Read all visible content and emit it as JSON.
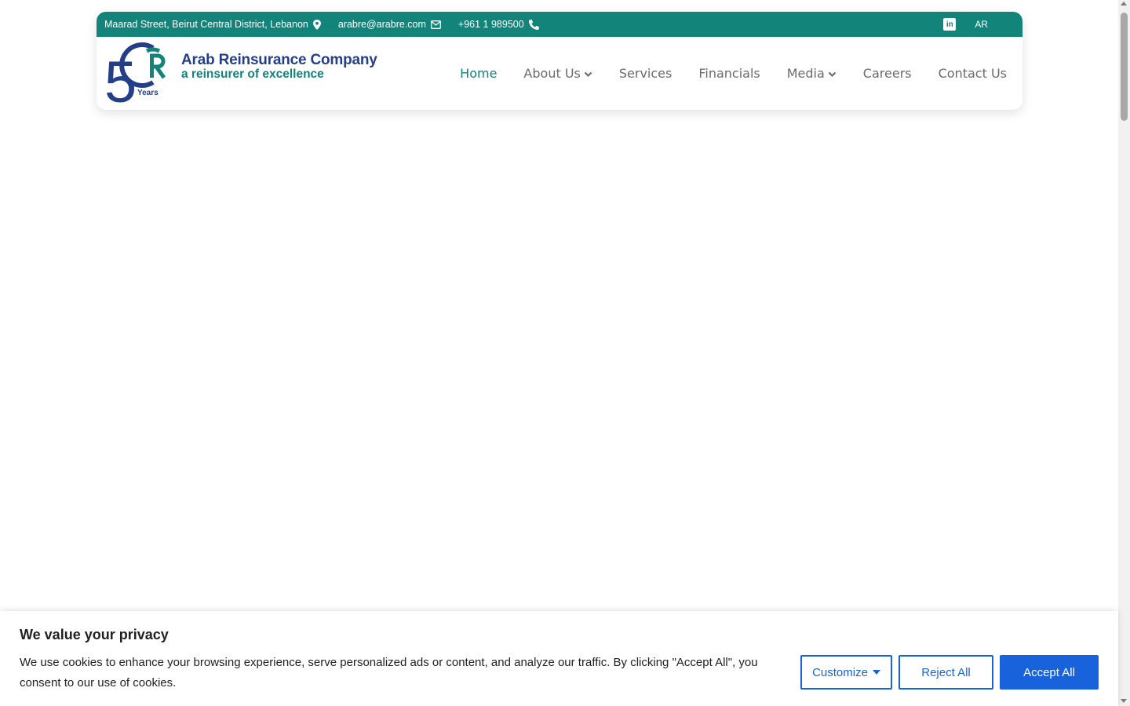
{
  "topbar": {
    "address": "Maarad Street, Beirut Central District, Lebanon",
    "email": "arabre@arabre.com",
    "phone": "+961 1 989500",
    "language": "AR",
    "icons": [
      "location-pin-icon",
      "envelope-icon",
      "phone-icon",
      "linkedin-icon"
    ]
  },
  "logo": {
    "number": "5",
    "years": "Years",
    "name": "Arab Reinsurance Company",
    "tagline": "a reinsurer of excellence"
  },
  "nav": {
    "items": [
      {
        "label": "Home",
        "active": true,
        "dropdown": false
      },
      {
        "label": "About Us",
        "active": false,
        "dropdown": true
      },
      {
        "label": "Services",
        "active": false,
        "dropdown": false
      },
      {
        "label": "Financials",
        "active": false,
        "dropdown": false
      },
      {
        "label": "Media",
        "active": false,
        "dropdown": true
      },
      {
        "label": "Careers",
        "active": false,
        "dropdown": false
      },
      {
        "label": "Contact Us",
        "active": false,
        "dropdown": false
      }
    ]
  },
  "cookie": {
    "title": "We value your privacy",
    "text": "We use cookies to enhance your browsing experience, serve personalized ads or content, and analyze our traffic. By clicking \"Accept All\", you consent to our use of cookies.",
    "customize_label": "Customize",
    "reject_label": "Reject All",
    "accept_label": "Accept All"
  },
  "colors": {
    "teal": "#13847a",
    "navy": "#243e8a",
    "cookie_blue": "#1863dc"
  }
}
